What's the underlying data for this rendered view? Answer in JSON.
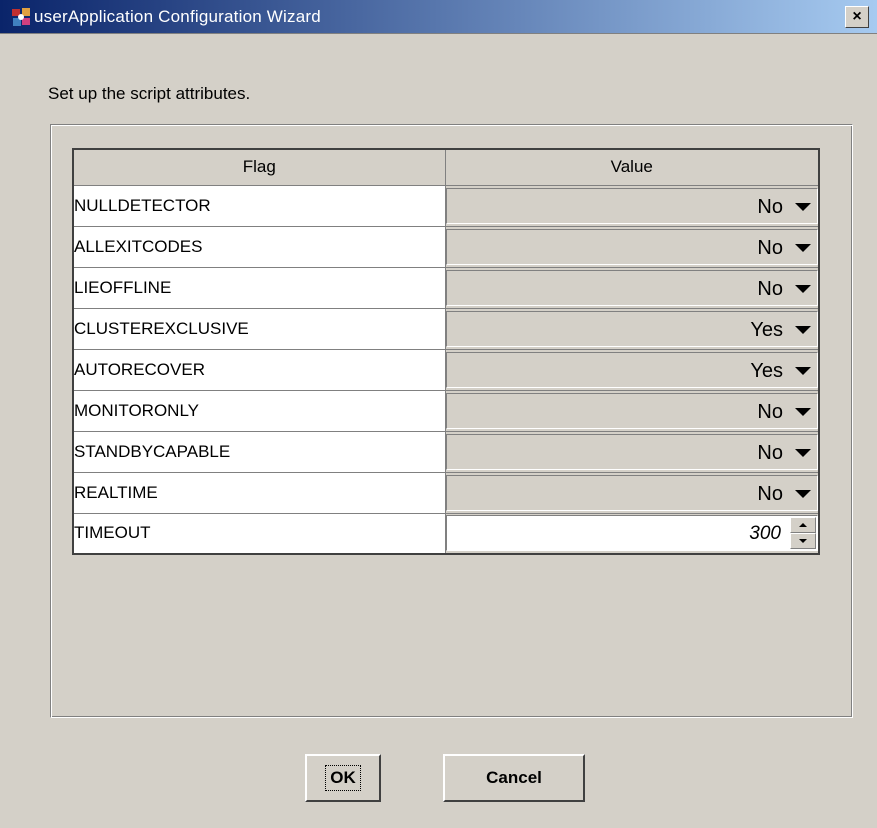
{
  "window": {
    "title": "userApplication Configuration Wizard",
    "close_label": "×"
  },
  "instruction": "Set up the script attributes.",
  "table": {
    "columns": [
      "Flag",
      "Value"
    ],
    "rows": [
      {
        "flag": "NULLDETECTOR",
        "value": "No",
        "control": "combo"
      },
      {
        "flag": "ALLEXITCODES",
        "value": "No",
        "control": "combo"
      },
      {
        "flag": "LIEOFFLINE",
        "value": "No",
        "control": "combo"
      },
      {
        "flag": "CLUSTEREXCLUSIVE",
        "value": "Yes",
        "control": "combo"
      },
      {
        "flag": "AUTORECOVER",
        "value": "Yes",
        "control": "combo"
      },
      {
        "flag": "MONITORONLY",
        "value": "No",
        "control": "combo"
      },
      {
        "flag": "STANDBYCAPABLE",
        "value": "No",
        "control": "combo"
      },
      {
        "flag": "REALTIME",
        "value": "No",
        "control": "combo"
      },
      {
        "flag": "TIMEOUT",
        "value": "300",
        "control": "spinner"
      }
    ]
  },
  "buttons": {
    "ok": "OK",
    "cancel": "Cancel"
  },
  "colors": {
    "dialog_bg": "#d4d0c8",
    "title_gradient_start": "#0a246a",
    "title_gradient_end": "#a6caf0"
  },
  "icons": {
    "app": "application-icon",
    "dropdown": "chevron-down-icon",
    "spin_up": "spin-up-icon",
    "spin_down": "spin-down-icon"
  }
}
